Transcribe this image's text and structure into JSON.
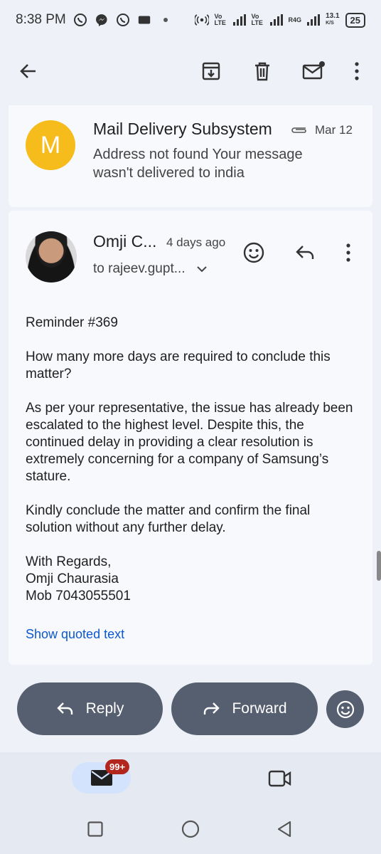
{
  "status_bar": {
    "time": "8:38 PM",
    "net_speed": "13.1",
    "net_unit": "K/S",
    "battery": "25",
    "network_labels": [
      "Vo LTE",
      "Vo LTE",
      "R4G"
    ]
  },
  "toolbar": {
    "icons": [
      "back-arrow-icon",
      "archive-icon",
      "delete-icon",
      "mark-unread-icon",
      "more-vert-icon"
    ]
  },
  "message_collapsed": {
    "avatar_letter": "M",
    "avatar_color": "#f5bc1c",
    "sender": "Mail Delivery Subsystem",
    "date": "Mar 12",
    "snippet": "Address not found Your message wasn't delivered to india"
  },
  "message_expanded": {
    "sender": "Omji C...",
    "date": "4 days ago",
    "to": "to rajeev.gupt...",
    "body": [
      "Reminder #369",
      "How many more days are required to conclude this matter?",
      "As per your representative, the issue has already been escalated to the highest level. Despite this, the continued delay in providing a clear resolution is extremely concerning for a company of Samsung’s stature.",
      "Kindly conclude the matter and confirm the final solution without any further delay."
    ],
    "signature": [
      "With Regards,",
      "Omji Chaurasia",
      "Mob 7043055501"
    ],
    "show_quoted": "Show quoted text"
  },
  "actions": {
    "reply": "Reply",
    "forward": "Forward"
  },
  "bottom_nav": {
    "mail_badge": "99+",
    "accent": "#d3e3fd",
    "badge_color": "#b3261e"
  },
  "colors": {
    "button_bg": "#565f6f",
    "link": "#0b57d0",
    "card_bg": "#f8f9fd",
    "page_bg": "#eef1f8"
  }
}
